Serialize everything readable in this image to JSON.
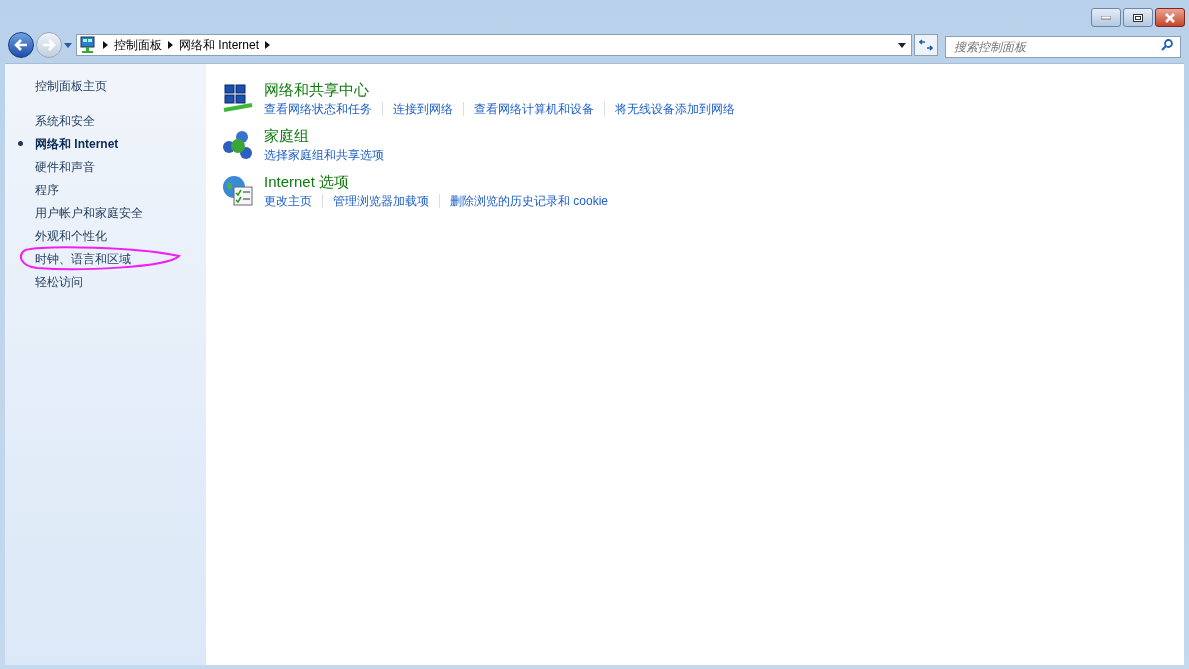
{
  "breadcrumb": [
    "控制面板",
    "网络和 Internet"
  ],
  "search": {
    "placeholder": "搜索控制面板"
  },
  "sidebar": {
    "home": "控制面板主页",
    "items": [
      {
        "label": "系统和安全",
        "selected": false
      },
      {
        "label": "网络和 Internet",
        "selected": true
      },
      {
        "label": "硬件和声音",
        "selected": false
      },
      {
        "label": "程序",
        "selected": false
      },
      {
        "label": "用户帐户和家庭安全",
        "selected": false
      },
      {
        "label": "外观和个性化",
        "selected": false
      },
      {
        "label": "时钟、语言和区域",
        "selected": false
      },
      {
        "label": "轻松访问",
        "selected": false
      }
    ]
  },
  "categories": [
    {
      "kind": "network",
      "title": "网络和共享中心",
      "links": [
        "查看网络状态和任务",
        "连接到网络",
        "查看网络计算机和设备",
        "将无线设备添加到网络"
      ]
    },
    {
      "kind": "homegroup",
      "title": "家庭组",
      "links": [
        "选择家庭组和共享选项"
      ]
    },
    {
      "kind": "internet",
      "title": "Internet 选项",
      "links": [
        "更改主页",
        "管理浏览器加载项",
        "删除浏览的历史记录和 cookie"
      ]
    }
  ]
}
